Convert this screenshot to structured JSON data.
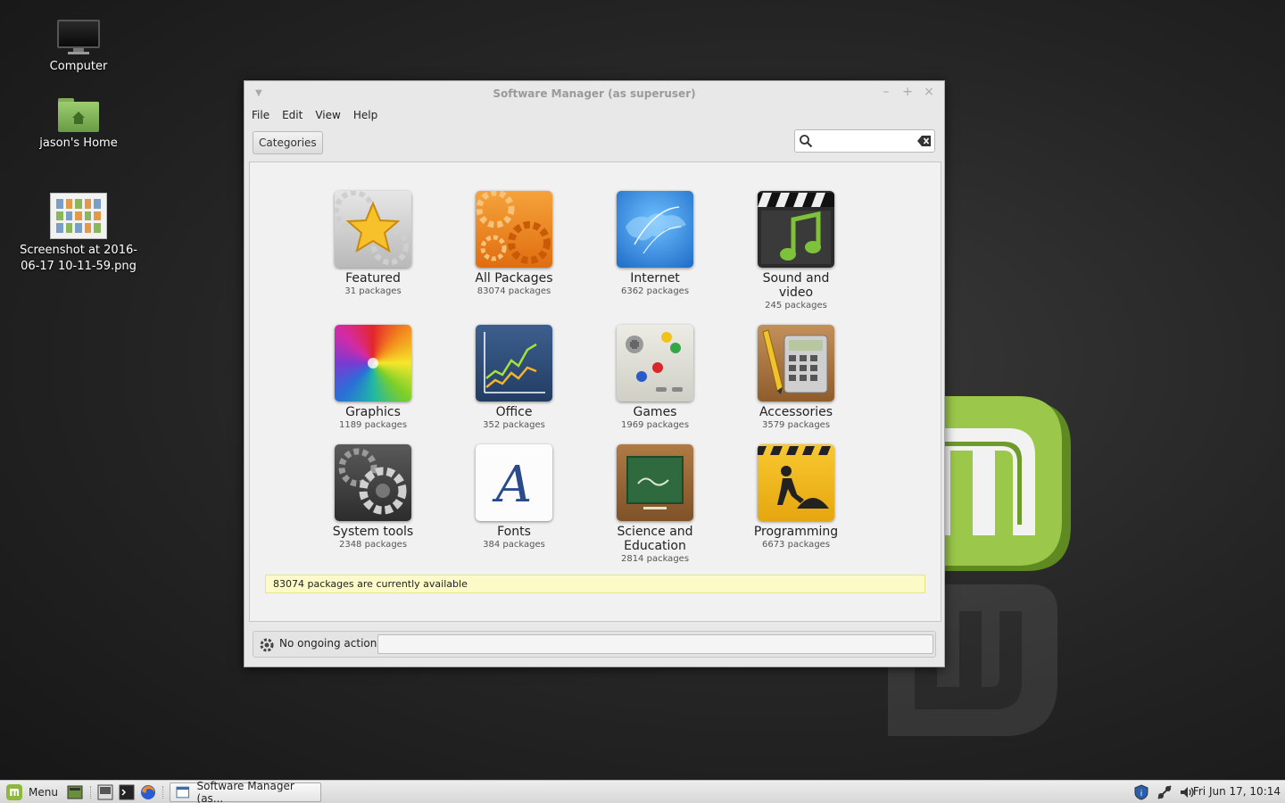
{
  "desktop": {
    "icons": [
      {
        "label": "Computer",
        "icon": "computer-icon"
      },
      {
        "label": "jason's Home",
        "icon": "home-folder-icon"
      },
      {
        "label": "Screenshot at 2016-06-17 10-11-59.png",
        "icon": "image-file-icon"
      }
    ]
  },
  "window": {
    "title": "Software Manager (as superuser)",
    "controls": {
      "minimize": "–",
      "maximize": "+",
      "close": "×"
    },
    "menu": [
      "File",
      "Edit",
      "View",
      "Help"
    ],
    "toolbar": {
      "categories_label": "Categories",
      "search_placeholder": ""
    },
    "categories": [
      {
        "name": "Featured",
        "count": "31 packages",
        "icon": "featured-star-icon"
      },
      {
        "name": "All Packages",
        "count": "83074 packages",
        "icon": "all-packages-gears-icon"
      },
      {
        "name": "Internet",
        "count": "6362 packages",
        "icon": "internet-globe-icon"
      },
      {
        "name": "Sound and video",
        "count": "245 packages",
        "icon": "sound-video-clapper-icon"
      },
      {
        "name": "Graphics",
        "count": "1189 packages",
        "icon": "graphics-spectrum-icon"
      },
      {
        "name": "Office",
        "count": "352 packages",
        "icon": "office-chart-icon"
      },
      {
        "name": "Games",
        "count": "1969 packages",
        "icon": "games-gamepad-icon"
      },
      {
        "name": "Accessories",
        "count": "3579 packages",
        "icon": "accessories-calculator-icon"
      },
      {
        "name": "System tools",
        "count": "2348 packages",
        "icon": "system-tools-gear-icon"
      },
      {
        "name": "Fonts",
        "count": "384 packages",
        "icon": "fonts-letter-icon"
      },
      {
        "name": "Science and Education",
        "count": "2814 packages",
        "icon": "science-chalkboard-icon"
      },
      {
        "name": "Programming",
        "count": "6673 packages",
        "icon": "programming-construction-icon"
      }
    ],
    "status_message": "83074 packages are currently available",
    "actions_label": "No ongoing actions"
  },
  "taskbar": {
    "menu_label": "Menu",
    "task_label": "Software Manager (as...",
    "clock": "Fri Jun 17, 10:14"
  },
  "colors": {
    "mint_green": "#8bb93d",
    "status_yellow": "#fcfbc7"
  }
}
